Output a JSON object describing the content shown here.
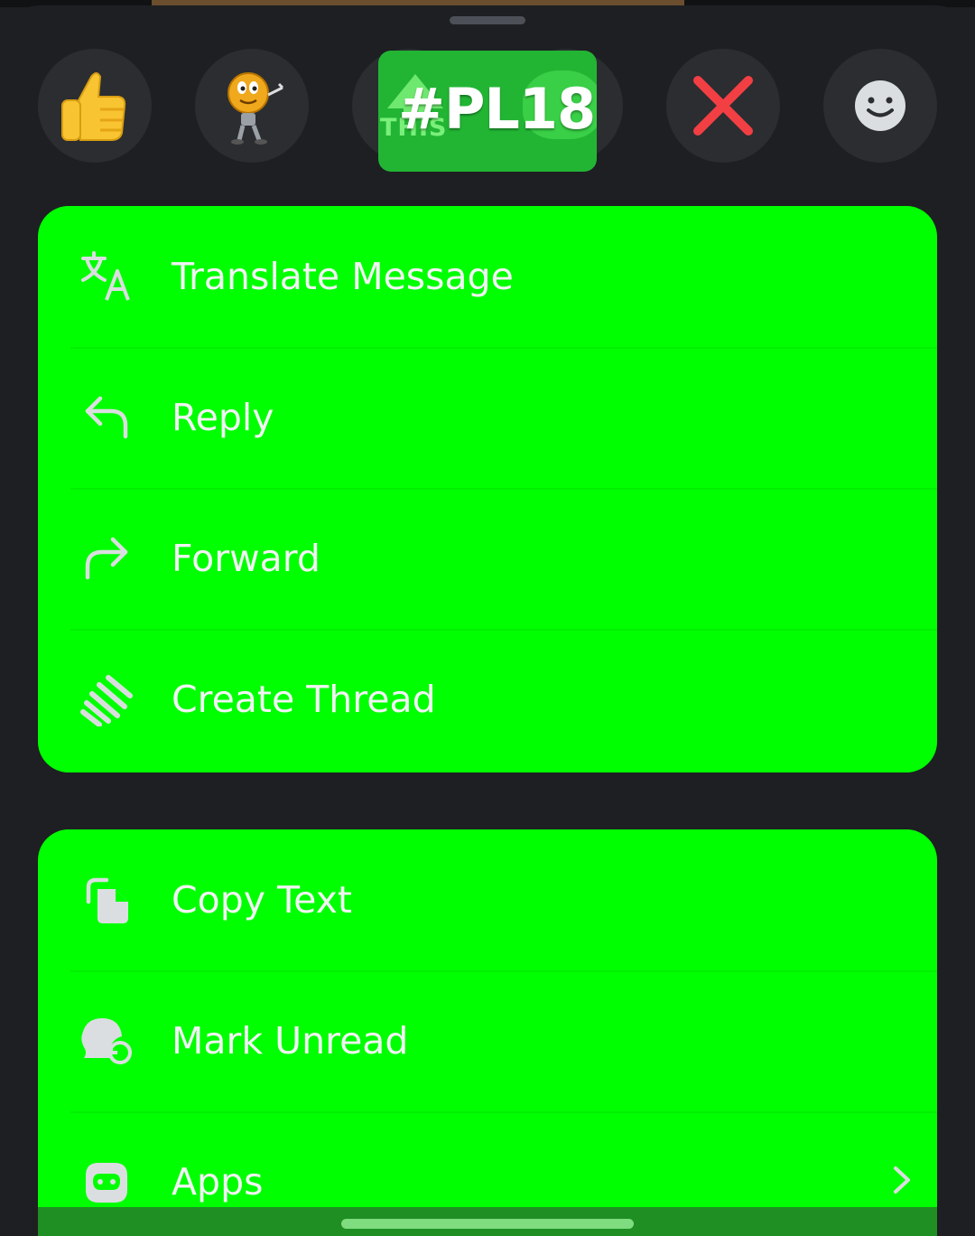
{
  "sticker": {
    "tag_text": "#PL18",
    "sub_text": "THIS"
  },
  "reactions": [
    {
      "name": "thumbs-up",
      "icon": "thumbs-up-icon"
    },
    {
      "name": "emoji-character",
      "icon": "smiley-character-icon"
    },
    {
      "name": "cross-mark",
      "icon": "red-x-icon"
    },
    {
      "name": "add-reaction",
      "icon": "add-reaction-smiley-icon"
    }
  ],
  "menu_primary": [
    {
      "label": "Translate Message",
      "icon": "translate-icon"
    },
    {
      "label": "Reply",
      "icon": "reply-icon"
    },
    {
      "label": "Forward",
      "icon": "forward-icon"
    },
    {
      "label": "Create Thread",
      "icon": "thread-icon"
    }
  ],
  "menu_secondary": [
    {
      "label": "Copy Text",
      "icon": "copy-icon"
    },
    {
      "label": "Mark Unread",
      "icon": "mark-unread-icon"
    },
    {
      "label": "Apps",
      "icon": "apps-robot-icon",
      "has_submenu": true
    }
  ],
  "colors": {
    "background": "#1e1f22",
    "card": "#00ff00",
    "text": "#f2f3f5",
    "reaction_bg": "#2b2d31",
    "red_x": "#f23f43"
  }
}
